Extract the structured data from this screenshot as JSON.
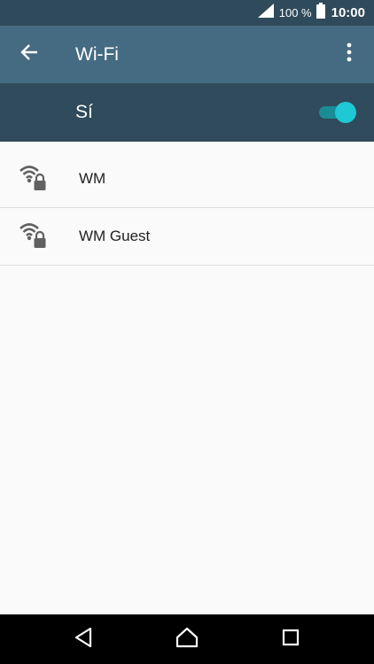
{
  "status_bar": {
    "battery_percent": "100 %",
    "time": "10:00",
    "icons": [
      "signal-icon",
      "battery-icon"
    ]
  },
  "app_bar": {
    "title": "Wi-Fi",
    "icons": [
      "back-arrow-icon",
      "more-vert-icon"
    ]
  },
  "wifi_toggle": {
    "label": "Sí",
    "state": "on",
    "accent_color": "#1ec8d5"
  },
  "networks": [
    {
      "name": "WM",
      "icon": "wifi-locked-icon"
    },
    {
      "name": "WM Guest",
      "icon": "wifi-locked-icon"
    }
  ],
  "nav_bar": {
    "icons": [
      "back-triangle-icon",
      "home-icon",
      "recents-icon"
    ]
  },
  "colors": {
    "status_bar_bg": "#2f4a5a",
    "app_bar_bg": "#456b82",
    "toggle_bar_bg": "#2f4b5c",
    "list_bg": "#fafafa"
  }
}
